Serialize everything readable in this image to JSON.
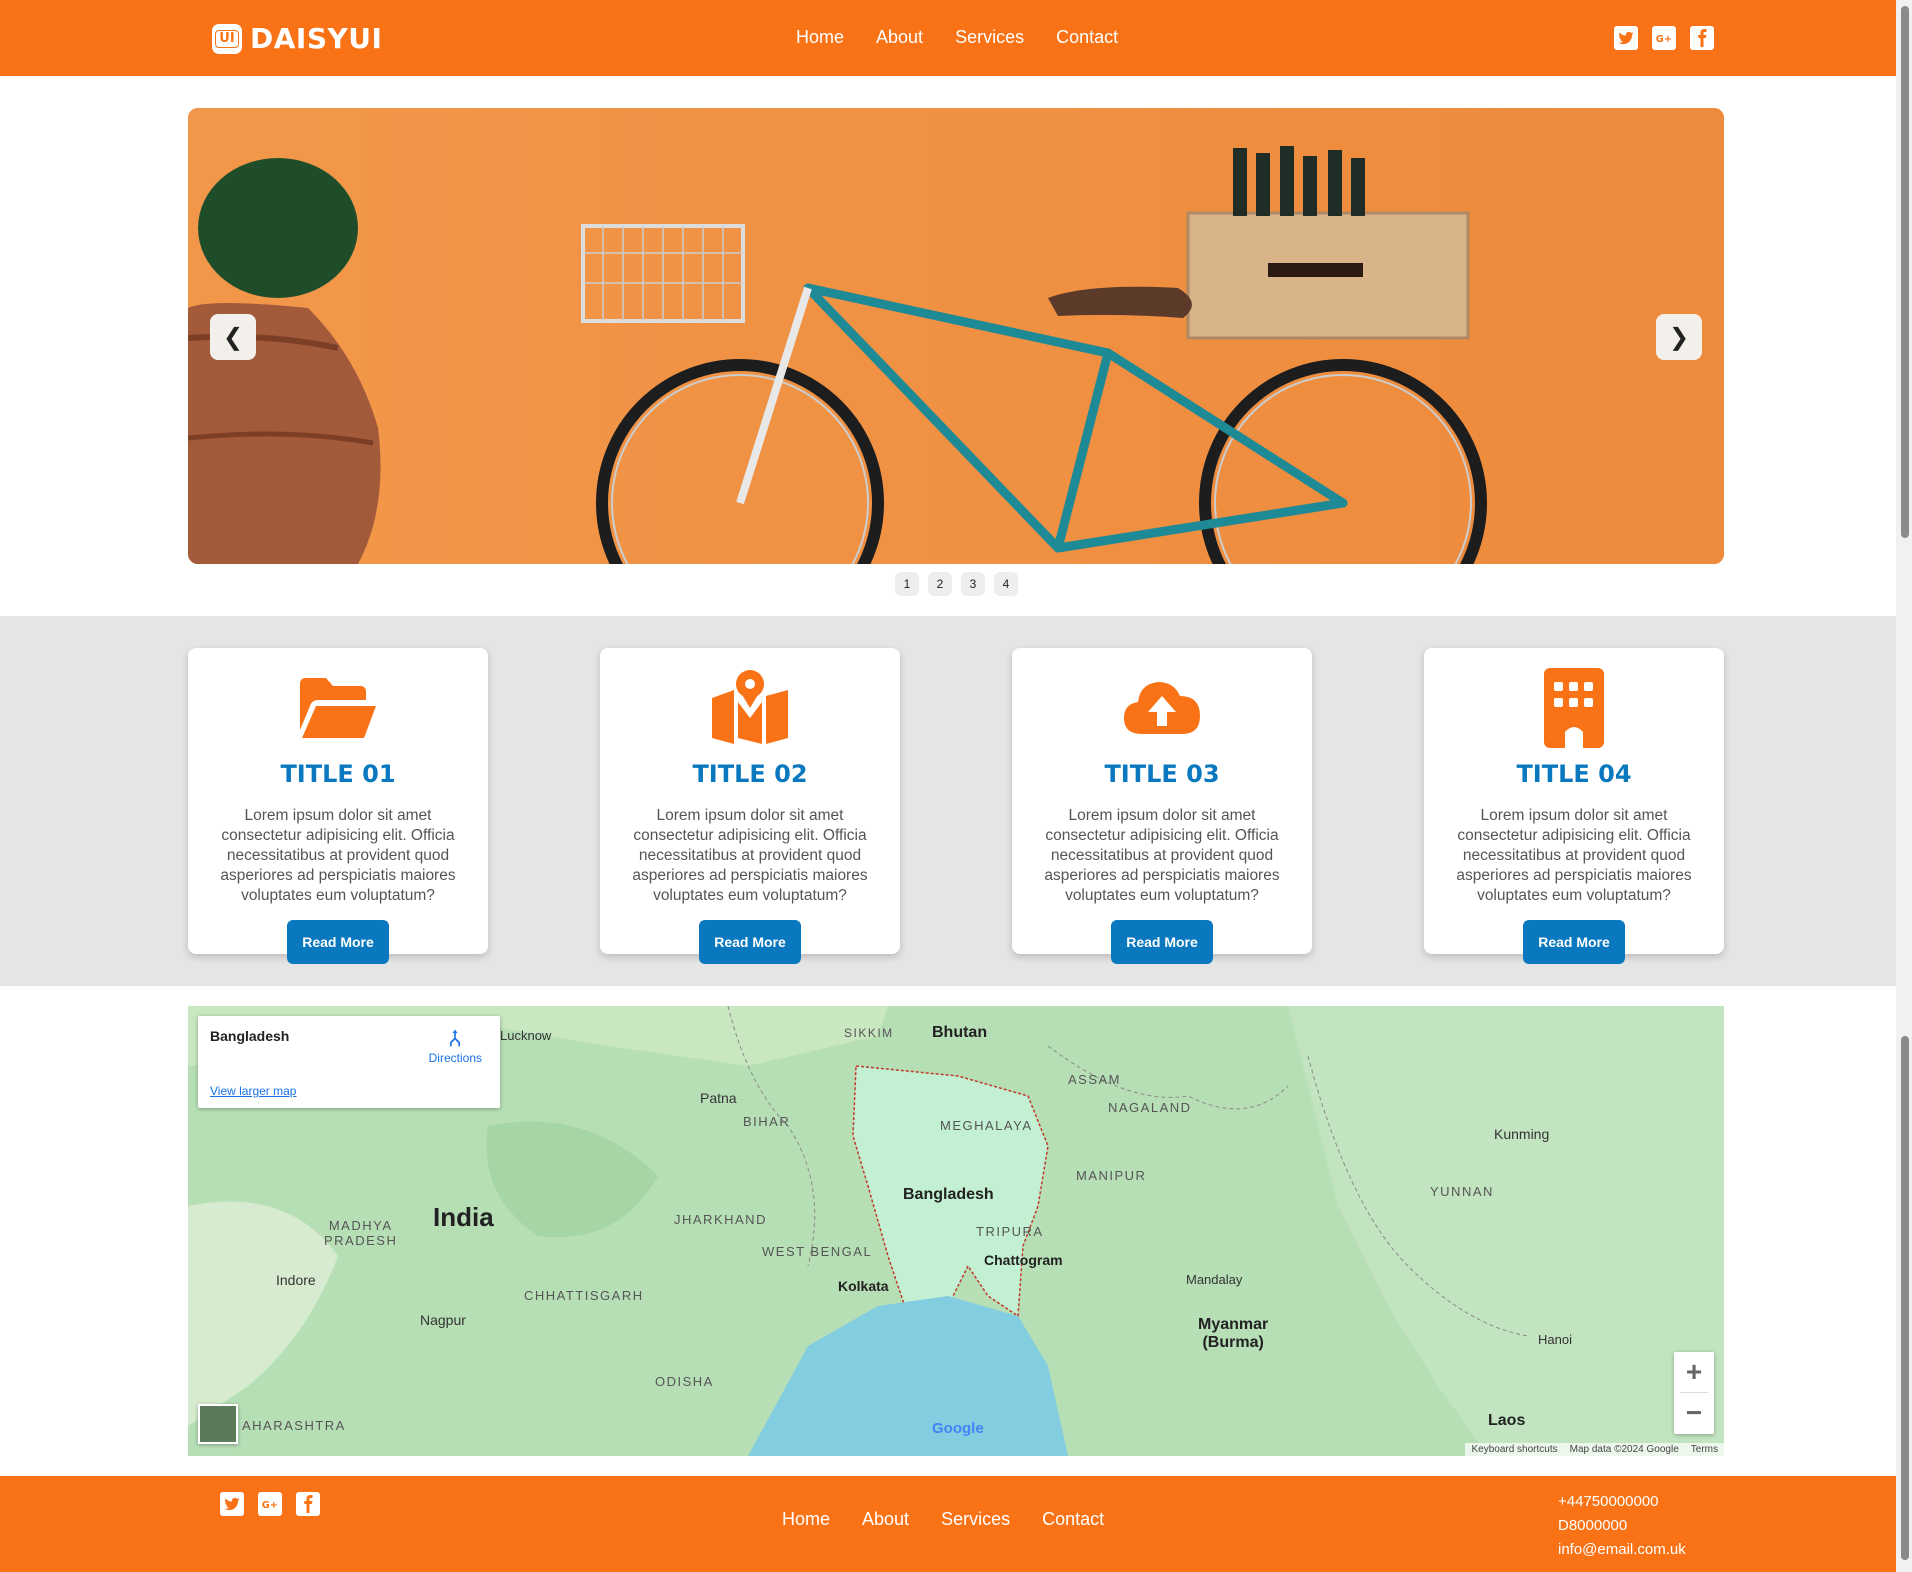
{
  "brand": {
    "badge": "UI",
    "name": "DAISYUI",
    "accent": "#f97316",
    "title_color": "#0a78be"
  },
  "nav": {
    "home": "Home",
    "about": "About",
    "services": "Services",
    "contact": "Contact"
  },
  "social_icons": [
    "twitter-icon",
    "google-plus-icon",
    "facebook-icon"
  ],
  "carousel": {
    "prev": "❮",
    "next": "❯",
    "slides": [
      "1",
      "2",
      "3",
      "4"
    ]
  },
  "cards": [
    {
      "icon": "folder-open-icon",
      "title": "TITLE 01",
      "text": "Lorem ipsum dolor sit amet consectetur adipisicing elit. Officia necessitatibus at provident quod asperiores ad perspiciatis maiores voluptates eum voluptatum?",
      "button": "Read More"
    },
    {
      "icon": "map-pin-icon",
      "title": "TITLE 02",
      "text": "Lorem ipsum dolor sit amet consectetur adipisicing elit. Officia necessitatibus at provident quod asperiores ad perspiciatis maiores voluptates eum voluptatum?",
      "button": "Read More"
    },
    {
      "icon": "cloud-upload-icon",
      "title": "TITLE 03",
      "text": "Lorem ipsum dolor sit amet consectetur adipisicing elit. Officia necessitatibus at provident quod asperiores ad perspiciatis maiores voluptates eum voluptatum?",
      "button": "Read More"
    },
    {
      "icon": "building-icon",
      "title": "TITLE 04",
      "text": "Lorem ipsum dolor sit amet consectetur adipisicing elit. Officia necessitatibus at provident quod asperiores ad perspiciatis maiores voluptates eum voluptatum?",
      "button": "Read More"
    }
  ],
  "map": {
    "place": "Bangladesh",
    "directions": "Directions",
    "view_larger": "View larger map",
    "zoom_in": "+",
    "zoom_out": "−",
    "google": "Google",
    "attribution": {
      "shortcuts": "Keyboard shortcuts",
      "data": "Map data ©2024 Google",
      "terms": "Terms"
    },
    "labels": {
      "india": "India",
      "bangladesh": "Bangladesh",
      "myanmar": "Myanmar\n(Burma)",
      "bhutan": "Bhutan",
      "kolkata": "Kolkata",
      "chattogram": "Chattogram",
      "mandalay": "Mandalay",
      "laos": "Laos",
      "kunming": "Kunming",
      "patna": "Patna",
      "nagpur": "Nagpur",
      "indore": "Indore",
      "lucknow": "Lucknow",
      "hanoi": "Hanoi",
      "madhya_pradesh": "MADHYA\nPRADESH",
      "jharkhand": "JHARKHAND",
      "west_bengal": "WEST BENGAL",
      "chhattisgarh": "CHHATTISGARH",
      "meghalaya": "MEGHALAYA",
      "assam": "ASSAM",
      "nagaland": "NAGALAND",
      "manipur": "MANIPUR",
      "tripura": "TRIPURA",
      "yunnan": "YUNNAN",
      "sikkim": "SIKKIM",
      "odisha": "ODISHA",
      "bihar": "BIHAR",
      "maharashtra": "AHARASHTRA"
    }
  },
  "footer": {
    "phone": "+44750000000",
    "code": "D8000000",
    "email": "info@email.com.uk"
  }
}
